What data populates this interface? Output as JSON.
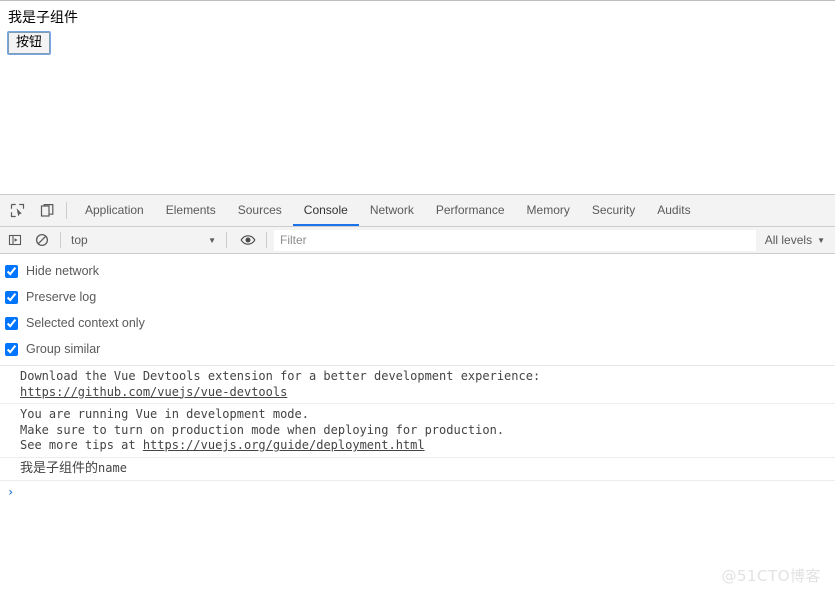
{
  "page": {
    "heading": "我是子组件",
    "button_label": "按钮"
  },
  "devtools": {
    "tabs": [
      {
        "label": "Application",
        "active": false
      },
      {
        "label": "Elements",
        "active": false
      },
      {
        "label": "Sources",
        "active": false
      },
      {
        "label": "Console",
        "active": true
      },
      {
        "label": "Network",
        "active": false
      },
      {
        "label": "Performance",
        "active": false
      },
      {
        "label": "Memory",
        "active": false
      },
      {
        "label": "Security",
        "active": false
      },
      {
        "label": "Audits",
        "active": false
      }
    ],
    "tab_icons": {
      "inspect": "inspect-element-icon",
      "device": "device-toolbar-icon"
    },
    "toolbar": {
      "sidebar_toggle_icon": "console-sidebar-icon",
      "clear_icon": "clear-console-icon",
      "context": "top",
      "context_caret": "▼",
      "eye_icon": "live-expression-eye-icon",
      "filter_placeholder": "Filter",
      "filter_value": "",
      "levels_label": "All levels",
      "levels_caret": "▼"
    },
    "settings": [
      {
        "label": "Hide network",
        "checked": true
      },
      {
        "label": "Preserve log",
        "checked": true
      },
      {
        "label": "Selected context only",
        "checked": true
      },
      {
        "label": "Group similar",
        "checked": true
      }
    ],
    "messages": [
      {
        "id": "vue-devtools-tip",
        "line1": "Download the Vue Devtools extension for a better development experience:",
        "link": "https://github.com/vuejs/vue-devtools"
      },
      {
        "id": "vue-dev-mode-warning",
        "line1": "You are running Vue in development mode.",
        "line2": "Make sure to turn on production mode when deploying for production.",
        "line3_prefix": "See more tips at ",
        "line3_link": "https://vuejs.org/guide/deployment.html"
      },
      {
        "id": "app-log",
        "cn_text": "我是子组件的",
        "mono_text": "name"
      }
    ],
    "prompt": {
      "caret": "›",
      "value": ""
    }
  },
  "watermark": {
    "text": "@51CTO博客"
  },
  "colors": {
    "accent": "#1a73e8",
    "toolbar_bg": "#f3f3f3",
    "border": "#cdcdcd",
    "text": "#5a5a5a",
    "prompt_caret": "#2f7de1",
    "watermark": "#e2e2e2"
  }
}
